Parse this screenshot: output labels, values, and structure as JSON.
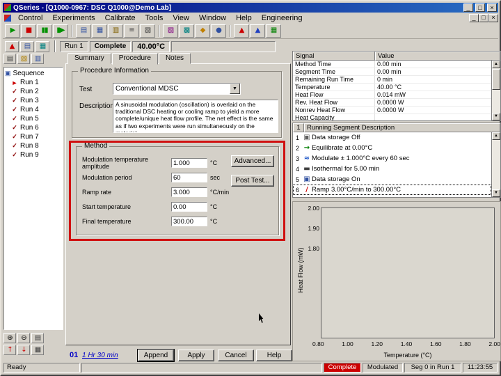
{
  "window": {
    "title": "QSeries - [Q1000-0967: DSC Q1000@Demo Lab]",
    "controls": {
      "minimize": "_",
      "maximize": "□",
      "close": "×"
    },
    "menu": [
      "Control",
      "Experiments",
      "Calibrate",
      "Tools",
      "View",
      "Window",
      "Help",
      "Engineering"
    ]
  },
  "toolbar": {
    "buttons": [
      {
        "name": "start-button",
        "icon": "start-icon",
        "glyph": "▶",
        "color": "#009000"
      },
      {
        "name": "stop-button",
        "icon": "stop-icon",
        "glyph": "■",
        "color": "#cc0000"
      },
      {
        "name": "pause-button",
        "icon": "pause-icon",
        "glyph": "▮▮",
        "color": "#009000"
      },
      {
        "name": "step-button",
        "icon": "step-icon",
        "glyph": "▮▶",
        "color": "#009000"
      },
      {
        "sep": true
      },
      {
        "name": "experiment-view-button",
        "icon": "experiment-view-icon",
        "glyph": "▤",
        "color": "#3050a0"
      },
      {
        "name": "procedure-view-button",
        "icon": "procedure-view-icon",
        "glyph": "▦",
        "color": "#3050a0"
      },
      {
        "name": "notes-view-button",
        "icon": "notes-view-icon",
        "glyph": "▥",
        "color": "#806000"
      },
      {
        "name": "run-list-button",
        "icon": "run-list-icon",
        "glyph": "≡",
        "color": "#404040"
      },
      {
        "name": "copy-run-button",
        "icon": "copy-icon",
        "glyph": "▧",
        "color": "#404040"
      },
      {
        "sep": true
      },
      {
        "name": "instrument-control-button",
        "icon": "instrument-icon",
        "glyph": "▨",
        "color": "#800080"
      },
      {
        "name": "signal-panel-button",
        "icon": "signal-panel-icon",
        "glyph": "▩",
        "color": "#008080"
      },
      {
        "name": "calibration-button",
        "icon": "calibration-icon",
        "glyph": "◆",
        "color": "#c08000"
      },
      {
        "name": "purge-gas-button",
        "icon": "purge-gas-icon",
        "glyph": "●",
        "color": "#3050a0"
      },
      {
        "sep": true
      },
      {
        "name": "analysis-button",
        "icon": "analysis-icon",
        "glyph": "▲",
        "color": "#cc0000"
      },
      {
        "name": "modulation-analysis-button",
        "icon": "modulation-analysis-icon",
        "glyph": "▲",
        "color": "#2040c0"
      },
      {
        "name": "wizard-button",
        "icon": "wizard-icon",
        "glyph": "▦",
        "color": "#008000"
      }
    ]
  },
  "instrument": {
    "buttons": [
      {
        "name": "alarm-button",
        "icon": "alarm-icon",
        "glyph": "▲",
        "color": "#cc0000"
      },
      {
        "name": "realtime-signal-button",
        "icon": "realtime-signal-icon",
        "glyph": "▤",
        "color": "#3050a0"
      },
      {
        "name": "plot-window-button",
        "icon": "plot-window-icon",
        "glyph": "▦",
        "color": "#008080"
      }
    ],
    "run_label": "Run 1",
    "status": "Complete",
    "temperature": "40.00°C"
  },
  "sequence": {
    "title": "Sequence",
    "root_icon_glyph": "▣",
    "current_glyph": "►",
    "check_glyph": "✓",
    "runs": [
      {
        "label": "Run 1",
        "state": "current"
      },
      {
        "label": "Run 2",
        "state": "done"
      },
      {
        "label": "Run 3",
        "state": "done"
      },
      {
        "label": "Run 4",
        "state": "done"
      },
      {
        "label": "Run 5",
        "state": "done"
      },
      {
        "label": "Run 6",
        "state": "done"
      },
      {
        "label": "Run 7",
        "state": "done"
      },
      {
        "label": "Run 8",
        "state": "done"
      },
      {
        "label": "Run 9",
        "state": "done"
      }
    ],
    "top_buttons": [
      {
        "name": "new-sequence-button",
        "icon": "new-sequence-icon",
        "glyph": "▤",
        "color": "#404040"
      },
      {
        "name": "open-sequence-button",
        "icon": "open-folder-icon",
        "glyph": "▧",
        "color": "#b08000"
      },
      {
        "name": "save-sequence-button",
        "icon": "save-icon",
        "glyph": "▥",
        "color": "#3050a0"
      }
    ],
    "bottom_row1": [
      {
        "name": "add-run-button",
        "icon": "add-run-icon",
        "glyph": "⊕",
        "color": "#000000"
      },
      {
        "name": "delete-run-button",
        "icon": "delete-run-icon",
        "glyph": "⊖",
        "color": "#000000"
      },
      {
        "name": "run-options-button",
        "icon": "run-options-icon",
        "glyph": "▤",
        "color": "#404040"
      }
    ],
    "bottom_row2": [
      {
        "name": "move-up-button",
        "icon": "arrow-up-icon",
        "glyph": "↑",
        "color": "#cc0000"
      },
      {
        "name": "move-down-button",
        "icon": "arrow-down-icon",
        "glyph": "↓",
        "color": "#cc0000"
      },
      {
        "name": "view-grid-button",
        "icon": "grid-icon",
        "glyph": "▦",
        "color": "#404040"
      }
    ]
  },
  "editor": {
    "tabs": [
      "Summary",
      "Procedure",
      "Notes"
    ],
    "procedure_info": {
      "title": "Procedure Information",
      "test_label": "Test",
      "test_value": "Conventional MDSC",
      "dropdown_glyph": "▼",
      "description_label": "Description",
      "description": "A sinusoidal modulation (oscillation) is overlaid on the traditional DSC heating or cooling ramp to yield a more complete/unique heat flow profile. The net effect is the same as if two experiments were run simultaneously on the material."
    },
    "method": {
      "title": "Method",
      "fields": [
        {
          "name": "modulation-amplitude",
          "label": "Modulation temperature amplitude",
          "value": "1.000",
          "unit": "°C"
        },
        {
          "name": "modulation-period",
          "label": "Modulation period",
          "value": "60",
          "unit": "sec"
        },
        {
          "name": "ramp-rate",
          "label": "Ramp rate",
          "value": "3.000",
          "unit": "°C/min"
        },
        {
          "name": "start-temperature",
          "label": "Start temperature",
          "value": "0.00",
          "unit": "°C"
        },
        {
          "name": "final-temperature",
          "label": "Final temperature",
          "value": "300.00",
          "unit": "°C"
        }
      ],
      "advanced_button": "Advanced...",
      "post_test_button": "Post Test..."
    },
    "footer": {
      "segment_index": "01",
      "estimated_time": "1 Hr 30 min",
      "buttons": [
        "Append",
        "Apply",
        "Cancel",
        "Help"
      ]
    }
  },
  "signals": {
    "columns": [
      "Signal",
      "Value"
    ],
    "rows": [
      [
        "Method Time",
        "0.00 min"
      ],
      [
        "Segment Time",
        "0.00 min"
      ],
      [
        "Remaining Run Time",
        "0 min"
      ],
      [
        "Temperature",
        "40.00 °C"
      ],
      [
        "Heat Flow",
        "0.014 mW"
      ],
      [
        "Rev. Heat Flow",
        "0.0000 W"
      ],
      [
        "Nonrev Heat Flow",
        "0.0000 W"
      ],
      [
        "Heat Capacity",
        ""
      ]
    ],
    "scroll_up_glyph": "▲",
    "scroll_down_glyph": "▼"
  },
  "segments": {
    "header_num": "1",
    "header": "Running Segment Description",
    "rows": [
      {
        "num": "1",
        "icon": "data-storage-off-icon",
        "glyph": "▣",
        "color": "#606060",
        "text": "Data storage Off"
      },
      {
        "num": "2",
        "icon": "equilibrate-icon",
        "glyph": "→",
        "color": "#008000",
        "text": "Equilibrate at 0.00°C"
      },
      {
        "num": "3",
        "icon": "modulate-icon",
        "glyph": "≈",
        "color": "#0040c0",
        "text": "Modulate ± 1.000°C every 60 sec"
      },
      {
        "num": "4",
        "icon": "isothermal-icon",
        "glyph": "▬",
        "color": "#404040",
        "text": "Isothermal for 5.00 min"
      },
      {
        "num": "5",
        "icon": "data-storage-on-icon",
        "glyph": "▣",
        "color": "#3050a0",
        "text": "Data storage On"
      },
      {
        "num": "6",
        "icon": "ramp-icon",
        "glyph": "/",
        "color": "#cc0000",
        "text": "Ramp 3.00°C/min to 300.00°C",
        "selected": true
      }
    ]
  },
  "chart_data": {
    "type": "line",
    "title": "",
    "xlabel": "Temperature (°C)",
    "ylabel": "Heat Flow (mW)",
    "xlim": [
      0.8,
      2.0
    ],
    "ylim": [
      1.8,
      2.0
    ],
    "x_ticks": [
      "0.80",
      "1.00",
      "1.20",
      "1.40",
      "1.60",
      "1.80",
      "2.00"
    ],
    "y_ticks": [
      "2.00",
      "1.90",
      "1.80"
    ],
    "grid": false,
    "legend": false,
    "series": []
  },
  "status": {
    "ready": "Ready",
    "complete": "Complete",
    "modulated": "Modulated",
    "run_info": "Seg 0 in Run 1",
    "time": "11:23:55"
  }
}
